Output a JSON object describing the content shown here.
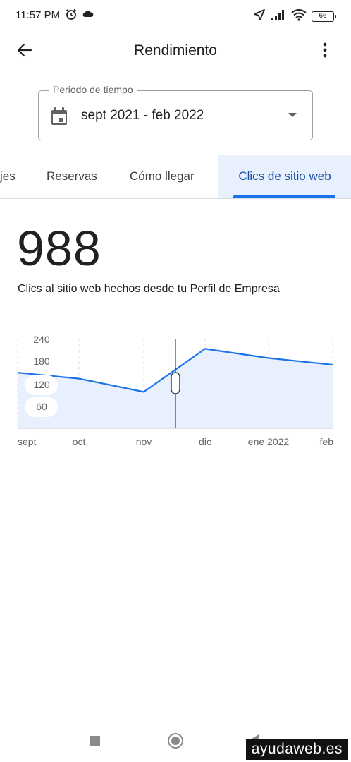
{
  "status_bar": {
    "time": "11:57 PM",
    "left_icons": [
      "alarm-icon",
      "cloud-icon"
    ],
    "right_icons": [
      "location-arrow-icon",
      "signal-icon",
      "wifi-icon"
    ],
    "battery": "66"
  },
  "app_bar": {
    "title": "Rendimiento",
    "back_icon": "arrow-back-icon",
    "more_icon": "more-vert-icon"
  },
  "period": {
    "label": "Periodo de tiempo",
    "value": "sept 2021 - feb 2022",
    "icon": "calendar-icon"
  },
  "tabs": [
    {
      "label": "jes",
      "active": false
    },
    {
      "label": "Reservas",
      "active": false
    },
    {
      "label": "Cómo llegar",
      "active": false
    },
    {
      "label": "Clics de sitio web",
      "active": true
    }
  ],
  "colors": {
    "accent": "#1a73e8",
    "line": "#1a73e8",
    "area": "#e8f0fe",
    "active_tab_text": "#174ea6"
  },
  "stat": {
    "value": "988",
    "description": "Clics al sitio web hechos desde tu Perfil de Empresa"
  },
  "chart_data": {
    "type": "area",
    "categories": [
      "sept",
      "oct",
      "nov",
      "dic",
      "ene 2022",
      "feb"
    ],
    "x": [
      "sept",
      "oct",
      "nov",
      "dic",
      "ene 2022",
      "feb"
    ],
    "series": [
      {
        "values": [
          165,
          150,
          110,
          240,
          212,
          192
        ]
      }
    ],
    "y_ticks": [
      "240",
      "180",
      "120",
      "60"
    ],
    "ylim": [
      0,
      260
    ],
    "grid": "vertical dashed",
    "scrubber_between": [
      "nov",
      "dic"
    ],
    "title": "",
    "xlabel": "",
    "ylabel": ""
  },
  "nav_bar": {
    "items": [
      "recents-button",
      "home-button",
      "back-button"
    ]
  },
  "watermark": "ayudaweb.es"
}
